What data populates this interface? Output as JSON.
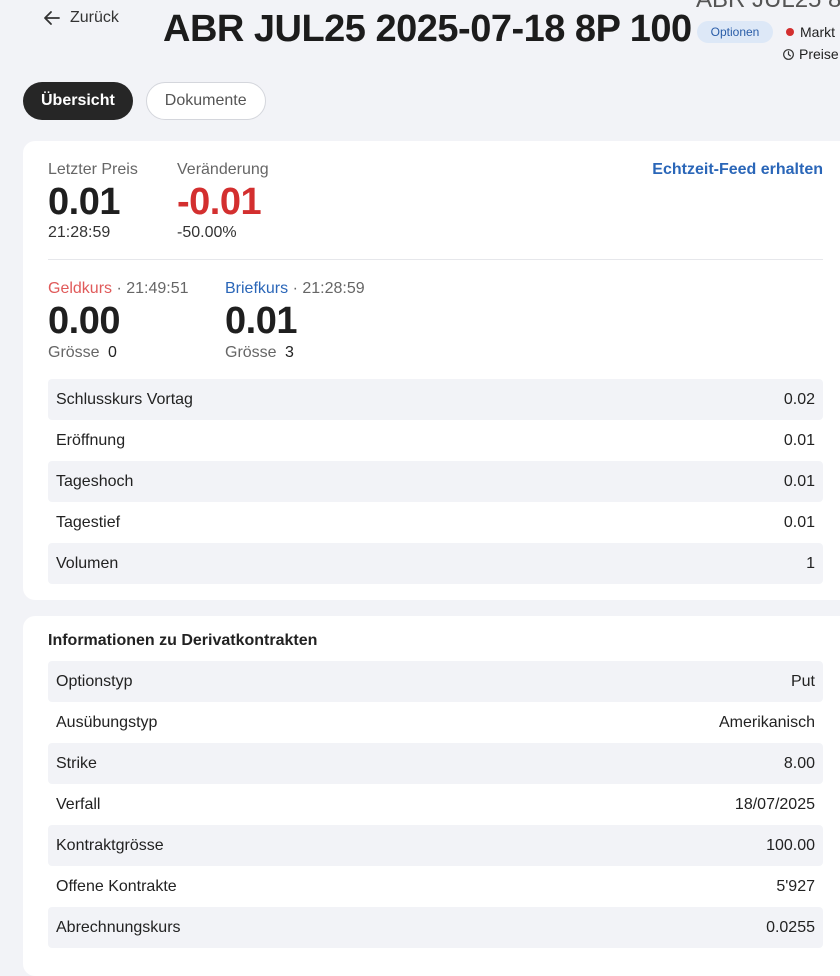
{
  "header": {
    "back_label": "Zurück",
    "title": "ABR JUL25 2025-07-18 8P 100",
    "title_clipped": "ABR JUL25 8",
    "badge": "Optionen",
    "status_text": "Markt",
    "prices_text": "Preise",
    "status_color": "#d32f2f"
  },
  "tabs": [
    {
      "label": "Übersicht",
      "active": true
    },
    {
      "label": "Dokumente",
      "active": false
    }
  ],
  "quote": {
    "last_price_label": "Letzter Preis",
    "last_price": "0.01",
    "last_time": "21:28:59",
    "change_label": "Veränderung",
    "change": "-0.01",
    "change_pct": "-50.00%",
    "change_color": "#d32f2f",
    "feed_link": "Echtzeit-Feed erhalten",
    "bid_label": "Geldkurs",
    "bid_time": "· 21:49:51",
    "bid": "0.00",
    "bid_size_label": "Grösse",
    "bid_size": "0",
    "ask_label": "Briefkurs",
    "ask_time": "· 21:28:59",
    "ask": "0.01",
    "ask_size_label": "Grösse",
    "ask_size": "3",
    "bid_color": "#e05a5a",
    "ask_color": "#2a66b8"
  },
  "stats": [
    {
      "label": "Schlusskurs Vortag",
      "value": "0.02"
    },
    {
      "label": "Eröffnung",
      "value": "0.01"
    },
    {
      "label": "Tageshoch",
      "value": "0.01"
    },
    {
      "label": "Tagestief",
      "value": "0.01"
    },
    {
      "label": "Volumen",
      "value": "1"
    }
  ],
  "derivative": {
    "title": "Informationen zu Derivatkontrakten",
    "rows": [
      {
        "label": "Optionstyp",
        "value": "Put"
      },
      {
        "label": "Ausübungstyp",
        "value": "Amerikanisch"
      },
      {
        "label": "Strike",
        "value": "8.00"
      },
      {
        "label": "Verfall",
        "value": "18/07/2025"
      },
      {
        "label": "Kontraktgrösse",
        "value": "100.00"
      },
      {
        "label": "Offene Kontrakte",
        "value": "5'927"
      },
      {
        "label": "Abrechnungskurs",
        "value": "0.0255"
      }
    ]
  }
}
